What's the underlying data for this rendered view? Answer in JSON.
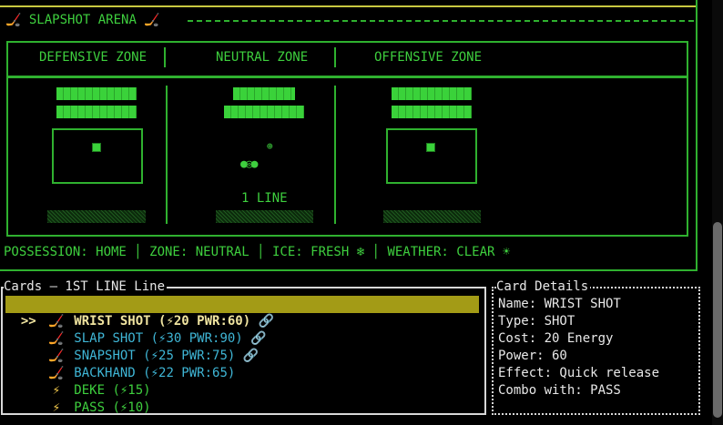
{
  "arena": {
    "title": "SLAPSHOT ARENA",
    "zones": [
      "DEFENSIVE ZONE",
      "NEUTRAL ZONE",
      "OFFENSIVE ZONE"
    ],
    "line_label": "1 LINE",
    "status": "POSSESSION: HOME │ ZONE: NEUTRAL │ ICE: FRESH ❄ │ WEATHER: CLEAR ☀"
  },
  "cards": {
    "title": "Cards – 1ST LINE Line",
    "items": [
      {
        "icon": "hockey-stick-icon",
        "glyph": "🏒",
        "text": "WRIST SHOT (⚡20 PWR:60)",
        "combo": "🔗",
        "selected": true
      },
      {
        "icon": "hockey-stick-icon",
        "glyph": "🏒",
        "text": "SLAP SHOT (⚡30 PWR:90)",
        "combo": "🔗",
        "selected": false
      },
      {
        "icon": "hockey-stick-icon",
        "glyph": "🏒",
        "text": "SNAPSHOT (⚡25 PWR:75)",
        "combo": "🔗",
        "selected": false
      },
      {
        "icon": "hockey-stick-icon",
        "glyph": "🏒",
        "text": "BACKHAND (⚡22 PWR:65)",
        "combo": "",
        "selected": false
      },
      {
        "icon": "lightning-icon",
        "glyph": "⚡",
        "text": "DEKE (⚡15)",
        "combo": "",
        "selected": false
      },
      {
        "icon": "lightning-icon",
        "glyph": "⚡",
        "text": "PASS (⚡10)",
        "combo": "",
        "selected": false
      }
    ],
    "selector": ">>"
  },
  "details": {
    "title": "Card Details",
    "lines": [
      "Name: WRIST SHOT",
      "Type: SHOT",
      "Cost: 20 Energy",
      "Power: 60",
      "Effect: Quick release",
      "Combo with: PASS"
    ]
  },
  "colors": {
    "accent": "#3ecf3e",
    "selected_bg": "#a39b16",
    "text_cyan": "#3fb6d6"
  }
}
